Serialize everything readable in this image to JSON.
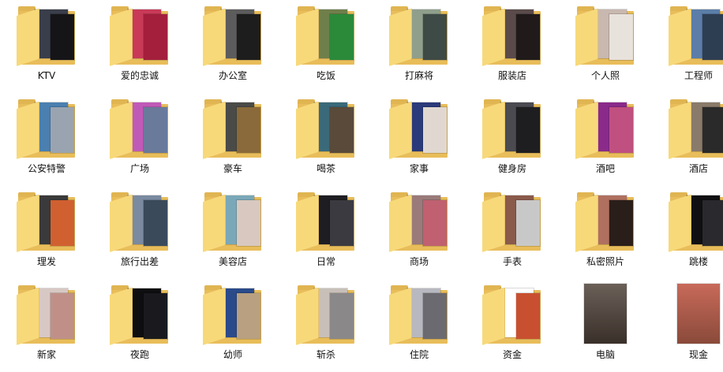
{
  "folders": [
    {
      "label": "KTV",
      "icon": "folder-icon",
      "c1": "#3a3e4a",
      "c2": "#151518"
    },
    {
      "label": "爱的忠诚",
      "icon": "folder-icon",
      "c1": "#c83a58",
      "c2": "#a31f3c"
    },
    {
      "label": "办公室",
      "icon": "folder-icon",
      "c1": "#5c5c5c",
      "c2": "#1d1d1d"
    },
    {
      "label": "吃饭",
      "icon": "folder-icon",
      "c1": "#6f7f4b",
      "c2": "#2a8a3a"
    },
    {
      "label": "打麻将",
      "icon": "folder-icon",
      "c1": "#8f9f8c",
      "c2": "#3e4a45"
    },
    {
      "label": "服装店",
      "icon": "folder-icon",
      "c1": "#5a4a4a",
      "c2": "#201a1a"
    },
    {
      "label": "个人照",
      "icon": "folder-icon",
      "c1": "#c8b8b0",
      "c2": "#e8e2dc"
    },
    {
      "label": "工程师",
      "icon": "folder-icon",
      "c1": "#5b7da8",
      "c2": "#2e3e52"
    },
    {
      "label": "公安特警",
      "icon": "folder-icon",
      "c1": "#4a7fb0",
      "c2": "#9aa4b0"
    },
    {
      "label": "广场",
      "icon": "folder-icon",
      "c1": "#c05ab8",
      "c2": "#6a7a9a"
    },
    {
      "label": "豪车",
      "icon": "folder-icon",
      "c1": "#4a4a48",
      "c2": "#8a6a3a"
    },
    {
      "label": "喝茶",
      "icon": "folder-icon",
      "c1": "#3a6a7a",
      "c2": "#5a4a3a"
    },
    {
      "label": "家事",
      "icon": "folder-icon",
      "c1": "#2a3a7a",
      "c2": "#e0d8d0"
    },
    {
      "label": "健身房",
      "icon": "folder-icon",
      "c1": "#4a4a50",
      "c2": "#1e1e20"
    },
    {
      "label": "酒吧",
      "icon": "folder-icon",
      "c1": "#8a2a8a",
      "c2": "#c05080"
    },
    {
      "label": "酒店",
      "icon": "folder-icon",
      "c1": "#8a7a6a",
      "c2": "#2a2a2a"
    },
    {
      "label": "理发",
      "icon": "folder-icon",
      "c1": "#3a3a3a",
      "c2": "#d06030"
    },
    {
      "label": "旅行出差",
      "icon": "folder-icon",
      "c1": "#7a8aa0",
      "c2": "#3a4a5a"
    },
    {
      "label": "美容店",
      "icon": "folder-icon",
      "c1": "#7aa8b8",
      "c2": "#d8c8c0"
    },
    {
      "label": "日常",
      "icon": "folder-icon",
      "c1": "#1e1e22",
      "c2": "#3a3a40"
    },
    {
      "label": "商场",
      "icon": "folder-icon",
      "c1": "#9a7a7a",
      "c2": "#c06070"
    },
    {
      "label": "手表",
      "icon": "folder-icon",
      "c1": "#8a5a4a",
      "c2": "#c8c8c8"
    },
    {
      "label": "私密照片",
      "icon": "folder-icon",
      "c1": "#b07060",
      "c2": "#2a1e1a"
    },
    {
      "label": "跳楼",
      "icon": "folder-icon",
      "c1": "#101012",
      "c2": "#2a2a2e"
    },
    {
      "label": "新家",
      "icon": "folder-icon",
      "c1": "#d8c8c4",
      "c2": "#c09088"
    },
    {
      "label": "夜跑",
      "icon": "folder-icon",
      "c1": "#0e0e10",
      "c2": "#1a1a1e"
    },
    {
      "label": "幼师",
      "icon": "folder-icon",
      "c1": "#2a4a8a",
      "c2": "#b8a080"
    },
    {
      "label": "斩杀",
      "icon": "folder-icon",
      "c1": "#c8c0b8",
      "c2": "#8a8888"
    },
    {
      "label": "住院",
      "icon": "folder-icon",
      "c1": "#b8b8c0",
      "c2": "#6a6a70"
    },
    {
      "label": "资金",
      "icon": "folder-icon",
      "c1": "#ffffff",
      "c2": "#c85030"
    }
  ],
  "files": [
    {
      "label": "电脑",
      "icon": "image-thumbnail-icon",
      "c1": "#6a6058",
      "c2": "#3a302a"
    },
    {
      "label": "现金",
      "icon": "image-thumbnail-icon",
      "c1": "#c86a5a",
      "c2": "#8a4a3a"
    }
  ]
}
